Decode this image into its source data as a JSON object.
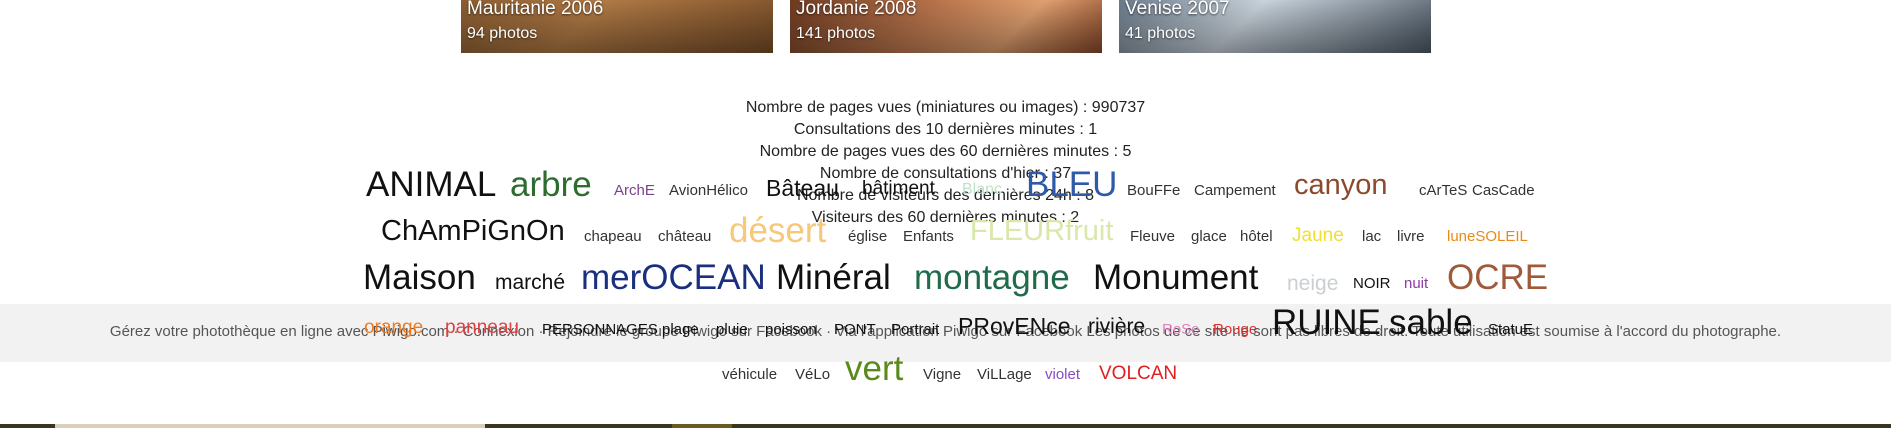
{
  "albums": [
    {
      "title": "Mauritanie 2006",
      "count": "94 photos"
    },
    {
      "title": "Jordanie 2008",
      "count": "141 photos"
    },
    {
      "title": "Venise 2007",
      "count": "41 photos"
    }
  ],
  "stats": [
    "Nombre de pages vues (miniatures ou images) : 990737",
    "Consultations des 10 dernières minutes : 1",
    "Nombre de pages vues des 60 dernières minutes : 5",
    "Nombre de consultations d'hier : 37",
    "Nombre de visiteurs des dernières 24h : 8",
    "Visiteurs des 60 dernières minutes : 2"
  ],
  "footer": "Gérez votre photothèque en ligne avec Piwigo.com · Connexion · Rejoindre le groupe Piwigo sur Facebook · Via l'application Piwigo sur Facebook Les photos de ce site ne sont pas libres de droit. Toute utilisation est soumise à l'accord du photographe.",
  "tags": [
    {
      "label": "ANIMAL",
      "color": "#111111"
    },
    {
      "label": "arbre",
      "color": "#2e6b2e"
    },
    {
      "label": "ArchE",
      "color": "#7b3f8f"
    },
    {
      "label": "AvionHélico",
      "color": "#333333"
    },
    {
      "label": "Bâteau",
      "color": "#111111"
    },
    {
      "label": "bâtiment",
      "color": "#111111"
    },
    {
      "label": "Blanc",
      "color": "#bfe3c8"
    },
    {
      "label": "BLEU",
      "color": "#2e5aa8"
    },
    {
      "label": "BouFFe",
      "color": "#333333"
    },
    {
      "label": "Campement",
      "color": "#333333"
    },
    {
      "label": "canyon",
      "color": "#8b4a2b"
    },
    {
      "label": "cArTeS",
      "color": "#333333"
    },
    {
      "label": "CasCade",
      "color": "#333333"
    },
    {
      "label": "ChAmPiGnOn",
      "color": "#111111"
    },
    {
      "label": "chapeau",
      "color": "#333333"
    },
    {
      "label": "château",
      "color": "#333333"
    },
    {
      "label": "désert",
      "color": "#f5c87a"
    },
    {
      "label": "église",
      "color": "#333333"
    },
    {
      "label": "Enfants",
      "color": "#333333"
    },
    {
      "label": "FLEURfruit",
      "color": "#d9e7a8"
    },
    {
      "label": "Fleuve",
      "color": "#333333"
    },
    {
      "label": "glace",
      "color": "#333333"
    },
    {
      "label": "hôtel",
      "color": "#333333"
    },
    {
      "label": "Jaune",
      "color": "#f0e030"
    },
    {
      "label": "lac",
      "color": "#333333"
    },
    {
      "label": "livre",
      "color": "#333333"
    },
    {
      "label": "luneSOLEIL",
      "color": "#e88a1a"
    },
    {
      "label": "Maison",
      "color": "#111111"
    },
    {
      "label": "marché",
      "color": "#111111"
    },
    {
      "label": "merOCEAN",
      "color": "#1a2f80"
    },
    {
      "label": "Minéral",
      "color": "#111111"
    },
    {
      "label": "montagne",
      "color": "#1f6b4a"
    },
    {
      "label": "Monument",
      "color": "#111111"
    },
    {
      "label": "neige",
      "color": "#c9cfd3"
    },
    {
      "label": "NOIR",
      "color": "#111111"
    },
    {
      "label": "nuit",
      "color": "#8a3aa8"
    },
    {
      "label": "OCRE",
      "color": "#a05a3a"
    },
    {
      "label": "orange",
      "color": "#f07a20"
    },
    {
      "label": "panneau",
      "color": "#e04040"
    },
    {
      "label": "PERSONNAGES",
      "color": "#111111"
    },
    {
      "label": "plage",
      "color": "#111111"
    },
    {
      "label": "pluie",
      "color": "#111111"
    },
    {
      "label": "poisson",
      "color": "#111111"
    },
    {
      "label": "PONT",
      "color": "#111111"
    },
    {
      "label": "Portrait",
      "color": "#111111"
    },
    {
      "label": "PRovENce",
      "color": "#111111"
    },
    {
      "label": "rivière",
      "color": "#111111"
    },
    {
      "label": "RoSe",
      "color": "#e080c0"
    },
    {
      "label": "Rouge",
      "color": "#e03030"
    },
    {
      "label": "RUINE",
      "color": "#111111"
    },
    {
      "label": "sable",
      "color": "#111111"
    },
    {
      "label": "StatuE",
      "color": "#111111"
    },
    {
      "label": "véhicule",
      "color": "#333333"
    },
    {
      "label": "VéLo",
      "color": "#333333"
    },
    {
      "label": "vert",
      "color": "#5a8a1a"
    },
    {
      "label": "Vigne",
      "color": "#333333"
    },
    {
      "label": "ViLLage",
      "color": "#333333"
    },
    {
      "label": "violet",
      "color": "#8a4ac8"
    },
    {
      "label": "VOLCAN",
      "color": "#e02020"
    }
  ]
}
